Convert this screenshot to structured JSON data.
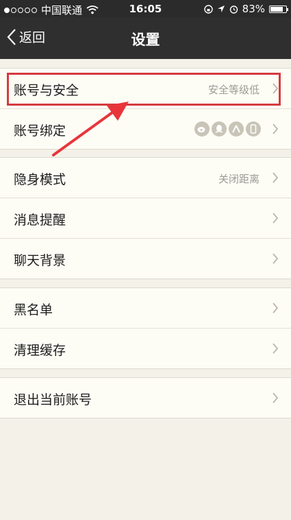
{
  "status": {
    "carrier": "中国联通",
    "time": "16:05",
    "battery": "83%",
    "battery_level": 0.83
  },
  "nav": {
    "back_label": "返回",
    "title": "设置"
  },
  "groups": [
    [
      {
        "label": "账号与安全",
        "value": "安全等级低"
      },
      {
        "label": "账号绑定",
        "value": ""
      }
    ],
    [
      {
        "label": "隐身模式",
        "value": "关闭距离"
      },
      {
        "label": "消息提醒",
        "value": ""
      },
      {
        "label": "聊天背景",
        "value": ""
      }
    ],
    [
      {
        "label": "黑名单",
        "value": ""
      },
      {
        "label": "清理缓存",
        "value": ""
      }
    ],
    [
      {
        "label": "退出当前账号",
        "value": ""
      }
    ]
  ],
  "binding_icons": [
    "weibo-icon",
    "qq-icon",
    "person-icon",
    "phone-icon"
  ]
}
